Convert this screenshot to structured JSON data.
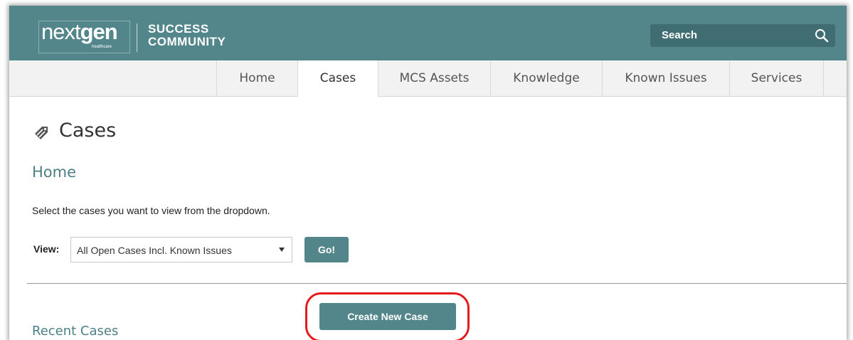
{
  "header": {
    "logo_word_prefix": "next",
    "logo_word_suffix": "gen",
    "logo_sub": "healthcare",
    "brand_line1": "SUCCESS",
    "brand_line2": "COMMUNITY",
    "search_label": "Search"
  },
  "nav": {
    "tabs": [
      {
        "label": "Home"
      },
      {
        "label": "Cases"
      },
      {
        "label": "MCS Assets"
      },
      {
        "label": "Knowledge"
      },
      {
        "label": "Known Issues"
      },
      {
        "label": "Services"
      }
    ],
    "active": "Cases"
  },
  "main": {
    "title": "Cases",
    "subtitle": "Home",
    "instructions": "Select the cases you want to view from the dropdown.",
    "view_label": "View:",
    "view_selected": "All Open Cases Incl. Known Issues",
    "go_label": "Go!",
    "create_label": "Create New Case",
    "recent_label": "Recent Cases"
  },
  "colors": {
    "brand": "#52868b",
    "highlight": "#e31b1b"
  },
  "icons": {
    "search": "search-icon",
    "title": "tag-icon"
  }
}
